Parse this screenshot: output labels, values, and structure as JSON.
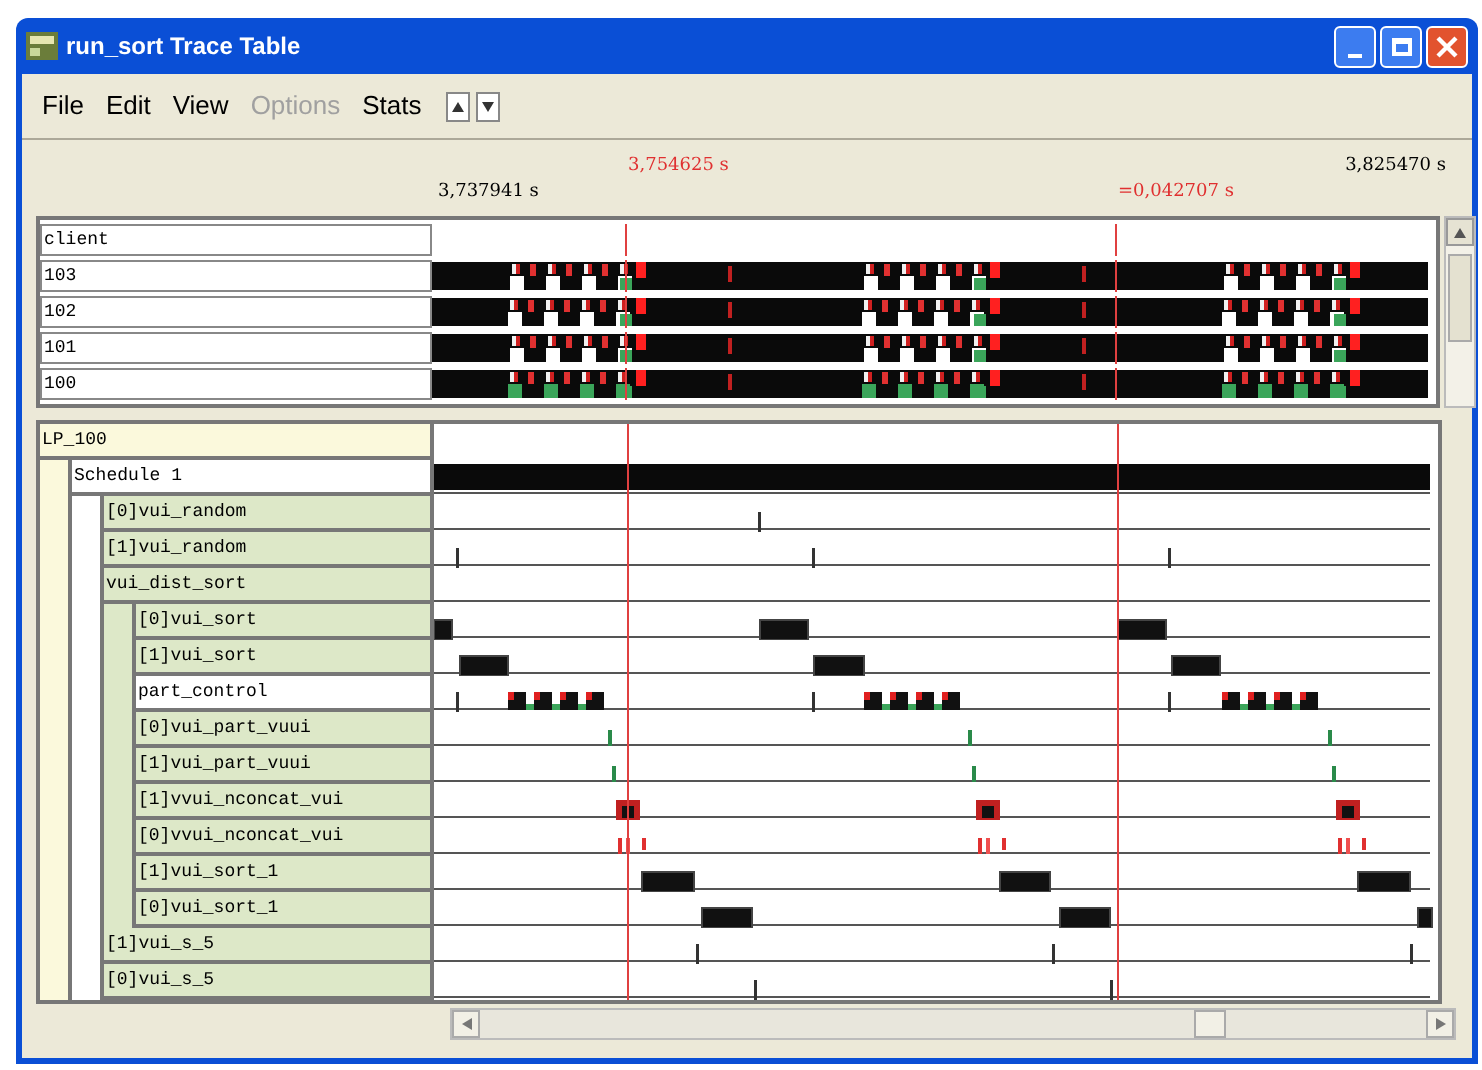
{
  "window": {
    "title": "run_sort Trace Table"
  },
  "menu": [
    {
      "label": "File",
      "disabled": false
    },
    {
      "label": "Edit",
      "disabled": false
    },
    {
      "label": "View",
      "disabled": false
    },
    {
      "label": "Options",
      "disabled": true
    },
    {
      "label": "Stats",
      "disabled": false
    }
  ],
  "ruler": {
    "start": "3,737941 s",
    "cursor_1": "3,754625 s",
    "cursor_2": "=0,042707 s",
    "end": "3,825470 s"
  },
  "clients": [
    {
      "label": "client",
      "kind": "header"
    },
    {
      "label": "103",
      "kind": "client"
    },
    {
      "label": "102",
      "kind": "client"
    },
    {
      "label": "101",
      "kind": "client"
    },
    {
      "label": "100",
      "kind": "client"
    }
  ],
  "tree": [
    {
      "label": "LP_100",
      "highlighted": false,
      "children": [
        {
          "label": "Schedule 1",
          "highlighted": true,
          "children": [
            {
              "label": "[0]vui_random",
              "highlighted": false
            },
            {
              "label": "[1]vui_random",
              "highlighted": false
            },
            {
              "label": "vui_dist_sort",
              "highlighted": false,
              "children": [
                {
                  "label": "[0]vui_sort",
                  "highlighted": false
                },
                {
                  "label": "[1]vui_sort",
                  "highlighted": false
                },
                {
                  "label": "part_control",
                  "highlighted": true
                },
                {
                  "label": "[0]vui_part_vuui",
                  "highlighted": false
                },
                {
                  "label": "[1]vui_part_vuui",
                  "highlighted": false
                },
                {
                  "label": "[1]vvui_nconcat_vui",
                  "highlighted": false
                },
                {
                  "label": "[0]vvui_nconcat_vui",
                  "highlighted": false
                },
                {
                  "label": "[1]vui_sort_1",
                  "highlighted": false
                },
                {
                  "label": "[0]vui_sort_1",
                  "highlighted": false
                }
              ]
            },
            {
              "label": "[1]vui_s_5",
              "highlighted": false
            },
            {
              "label": "[0]vui_s_5",
              "highlighted": false
            }
          ]
        }
      ]
    }
  ]
}
